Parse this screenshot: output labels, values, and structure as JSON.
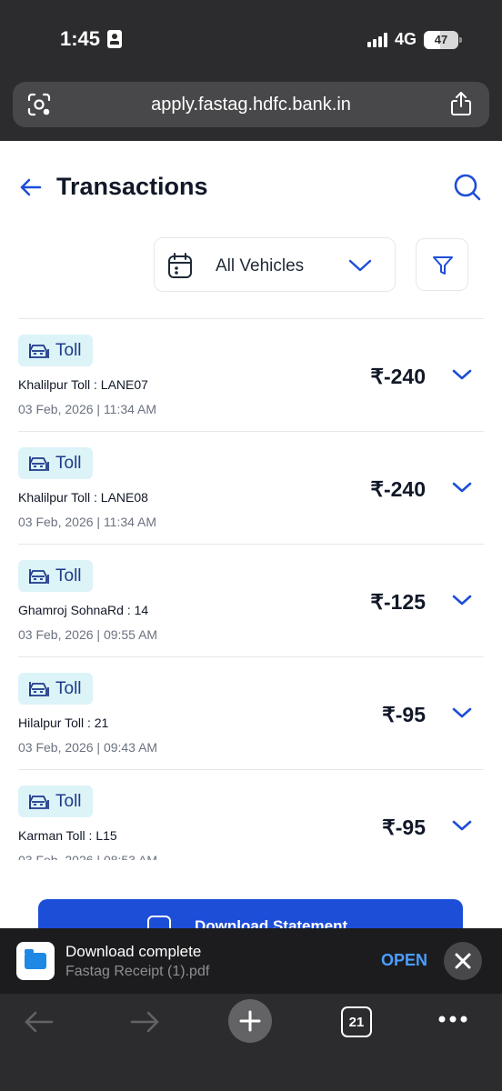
{
  "status_bar": {
    "time": "1:45",
    "network": "4G",
    "battery": "47",
    "battery_level": 0.47
  },
  "browser": {
    "url": "apply.fastag.hdfc.bank.in",
    "tab_count": "21"
  },
  "header": {
    "title": "Transactions"
  },
  "filters": {
    "vehicle": "All Vehicles"
  },
  "transactions": [
    {
      "tag": "Toll",
      "location": "Khalilpur Toll : LANE07",
      "date": "03 Feb, 2026",
      "time": "11:34 AM",
      "amount": "₹-240"
    },
    {
      "tag": "Toll",
      "location": "Khalilpur Toll : LANE08",
      "date": "03 Feb, 2026",
      "time": "11:34 AM",
      "amount": "₹-240"
    },
    {
      "tag": "Toll",
      "location": "Ghamroj SohnaRd : 14",
      "date": "03 Feb, 2026",
      "time": "09:55 AM",
      "amount": "₹-125"
    },
    {
      "tag": "Toll",
      "location": "Hilalpur Toll : 21",
      "date": "03 Feb, 2026",
      "time": "09:43 AM",
      "amount": "₹-95"
    },
    {
      "tag": "Toll",
      "location": "Karman Toll : L15",
      "date": "03 Feb, 2026",
      "time": "08:53 AM",
      "amount": "₹-95"
    }
  ],
  "download_button": {
    "label": "Download Statement"
  },
  "toast": {
    "title": "Download complete",
    "filename": "Fastag Receipt (1).pdf",
    "action": "OPEN"
  },
  "colors": {
    "accent": "#1d4ed8",
    "tag_bg": "#dcf3f8",
    "chrome": "#2c2c2e",
    "link": "#4a9eff"
  }
}
